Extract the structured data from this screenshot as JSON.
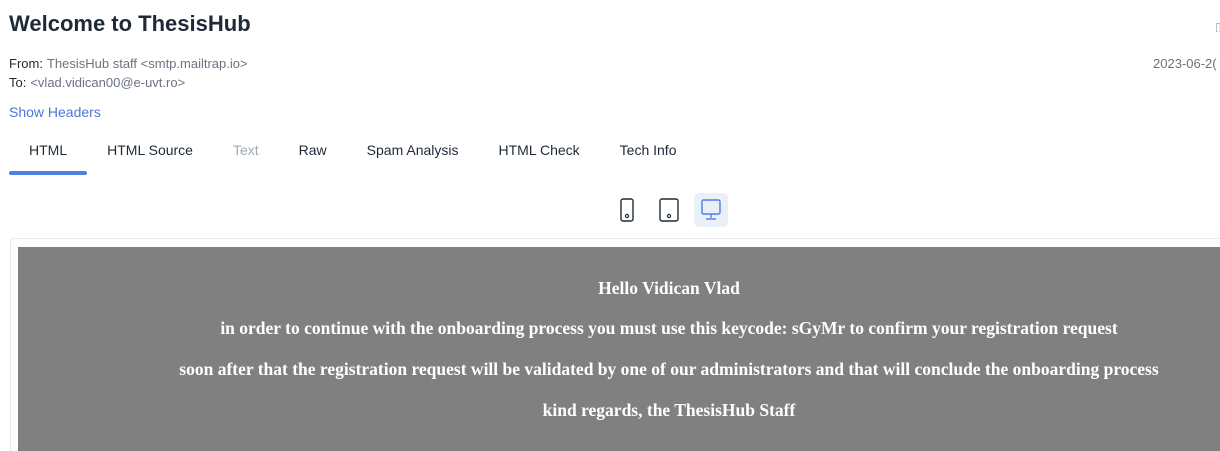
{
  "message": {
    "subject": "Welcome to ThesisHub",
    "from_label": "From:",
    "from_value": "ThesisHub staff <smtp.mailtrap.io>",
    "to_label": "To:",
    "to_value": "<vlad.vidican00@e-uvt.ro>",
    "date": "2023-06-2("
  },
  "show_headers_label": "Show Headers",
  "tabs": [
    {
      "label": "HTML",
      "state": "active"
    },
    {
      "label": "HTML Source",
      "state": "normal"
    },
    {
      "label": "Text",
      "state": "disabled"
    },
    {
      "label": "Raw",
      "state": "normal"
    },
    {
      "label": "Spam Analysis",
      "state": "normal"
    },
    {
      "label": "HTML Check",
      "state": "normal"
    },
    {
      "label": "Tech Info",
      "state": "normal"
    }
  ],
  "device_toggle": {
    "options": [
      "mobile-icon",
      "tablet-icon",
      "desktop-icon"
    ],
    "selected": "desktop-icon"
  },
  "email_body": {
    "background_color": "#808080",
    "text_color": "#ffffff",
    "lines": [
      "Hello Vidican Vlad",
      "in order to continue with the onboarding process you must use this keycode: sGyMr to confirm your registration request",
      "soon after that the registration request will be validated by one of our administrators and that will conclude the onboarding process",
      "kind regards, the ThesisHub Staff"
    ]
  },
  "colors": {
    "accent": "#4f7fe5",
    "link": "#4a78d6",
    "muted_text": "#6b7280",
    "disabled_text": "#a0a9b5",
    "active_device_bg": "#e9f0f7"
  }
}
